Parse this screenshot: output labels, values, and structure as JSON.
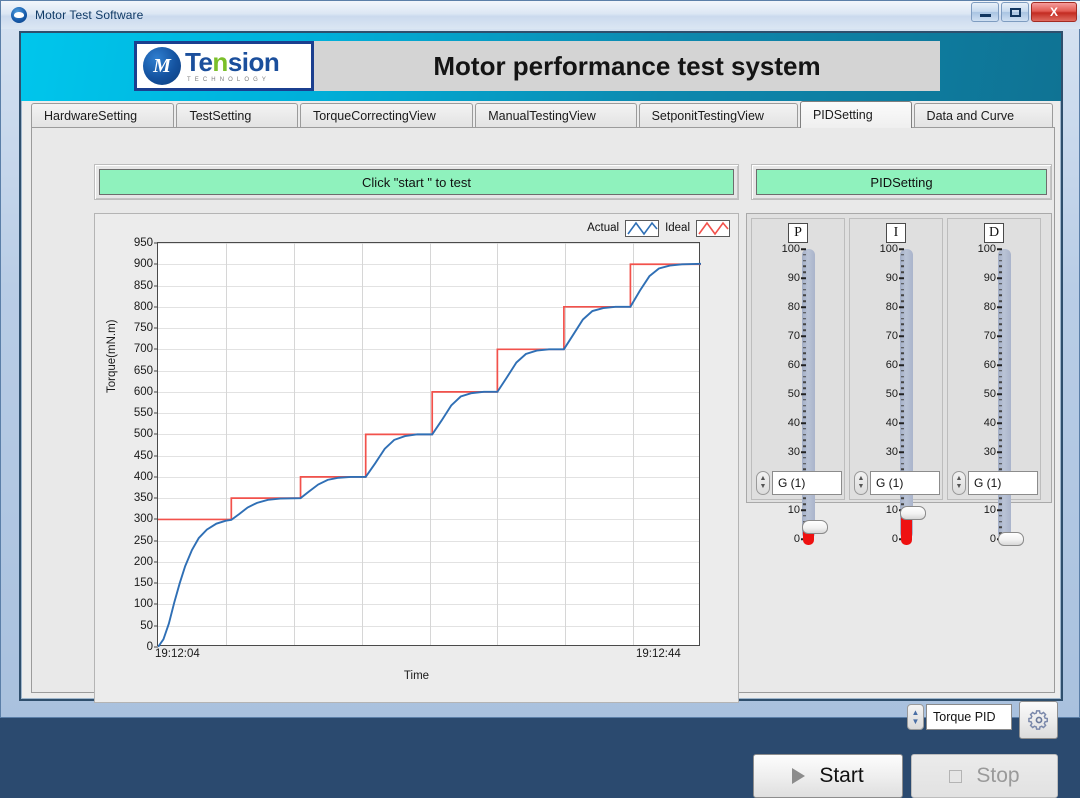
{
  "window": {
    "title": "Motor Test Software",
    "icon": "app-circle-icon",
    "buttons": {
      "minimize": "–",
      "maximize": "□",
      "close": "X"
    }
  },
  "header": {
    "title": "Motor performance test system",
    "logo": {
      "main_a": "Te",
      "main_n": "n",
      "main_b": "sion",
      "sub": "TECHNOLOGY",
      "mark": "M"
    }
  },
  "tabs": [
    {
      "label": "HardwareSetting",
      "active": false
    },
    {
      "label": "TestSetting",
      "active": false
    },
    {
      "label": "TorqueCorrectingView",
      "active": false
    },
    {
      "label": "ManualTestingView",
      "active": false
    },
    {
      "label": "SetponitTestingView",
      "active": false
    },
    {
      "label": "PIDSetting",
      "active": true
    },
    {
      "label": "Data and Curve",
      "active": false
    }
  ],
  "banners": {
    "left": "Click \"start \" to test",
    "right": "PIDSetting",
    "color": "#8ff2bd"
  },
  "legend": {
    "actual_label": "Actual",
    "ideal_label": "Ideal",
    "actual_color": "#2f6fb5",
    "ideal_color": "#f2514b"
  },
  "pid": {
    "sliders": [
      {
        "cap": "P",
        "value": 4,
        "readout": "G (1)"
      },
      {
        "cap": "I",
        "value": 9,
        "readout": "G (1)"
      },
      {
        "cap": "D",
        "value": 0,
        "readout": "G (1)"
      }
    ],
    "scale_max": 100,
    "scale_min": 0,
    "selector_value": "Torque PID",
    "gear_icon": "gear-icon"
  },
  "actions": {
    "start_label": "Start",
    "start_icon": "play-triangle-icon",
    "stop_label": "Stop",
    "stop_icon": "stop-square-icon",
    "stop_disabled": true
  },
  "chart_data": {
    "type": "line",
    "title": "",
    "xlabel": "Time",
    "ylabel": "Torque(mN.m)",
    "ylim": [
      0,
      950
    ],
    "yticks": [
      0,
      50,
      100,
      150,
      200,
      250,
      300,
      350,
      400,
      450,
      500,
      550,
      600,
      650,
      700,
      750,
      800,
      850,
      900,
      950
    ],
    "xlim_labels": [
      "19:12:04",
      "19:12:44"
    ],
    "x_start_seconds": 0,
    "x_end_seconds": 40,
    "grid": true,
    "legend_position": "top-right",
    "series": [
      {
        "name": "Ideal",
        "color": "#f2514b",
        "type": "step",
        "steps": [
          {
            "t": 0.0,
            "value": 300
          },
          {
            "t": 5.4,
            "value": 350
          },
          {
            "t": 10.5,
            "value": 400
          },
          {
            "t": 15.3,
            "value": 500
          },
          {
            "t": 20.2,
            "value": 600
          },
          {
            "t": 25.0,
            "value": 700
          },
          {
            "t": 29.9,
            "value": 800
          },
          {
            "t": 34.8,
            "value": 900
          },
          {
            "t": 40.0,
            "value": 900
          }
        ]
      },
      {
        "name": "Actual",
        "color": "#2f6fb5",
        "type": "response",
        "points": [
          {
            "t": 0.0,
            "value": 0
          },
          {
            "t": 0.4,
            "value": 18
          },
          {
            "t": 0.8,
            "value": 55
          },
          {
            "t": 1.2,
            "value": 105
          },
          {
            "t": 1.6,
            "value": 150
          },
          {
            "t": 2.0,
            "value": 190
          },
          {
            "t": 2.5,
            "value": 228
          },
          {
            "t": 3.0,
            "value": 256
          },
          {
            "t": 3.6,
            "value": 276
          },
          {
            "t": 4.3,
            "value": 290
          },
          {
            "t": 5.0,
            "value": 297
          },
          {
            "t": 5.4,
            "value": 299
          },
          {
            "t": 6.0,
            "value": 313
          },
          {
            "t": 6.6,
            "value": 328
          },
          {
            "t": 7.3,
            "value": 339
          },
          {
            "t": 8.1,
            "value": 346
          },
          {
            "t": 9.0,
            "value": 349
          },
          {
            "t": 10.5,
            "value": 350
          },
          {
            "t": 11.1,
            "value": 365
          },
          {
            "t": 11.8,
            "value": 382
          },
          {
            "t": 12.5,
            "value": 393
          },
          {
            "t": 13.3,
            "value": 398
          },
          {
            "t": 14.2,
            "value": 400
          },
          {
            "t": 15.3,
            "value": 400
          },
          {
            "t": 16.0,
            "value": 432
          },
          {
            "t": 16.7,
            "value": 466
          },
          {
            "t": 17.4,
            "value": 487
          },
          {
            "t": 18.2,
            "value": 496
          },
          {
            "t": 19.1,
            "value": 500
          },
          {
            "t": 20.2,
            "value": 500
          },
          {
            "t": 20.9,
            "value": 533
          },
          {
            "t": 21.6,
            "value": 568
          },
          {
            "t": 22.3,
            "value": 589
          },
          {
            "t": 23.1,
            "value": 597
          },
          {
            "t": 24.0,
            "value": 600
          },
          {
            "t": 25.0,
            "value": 600
          },
          {
            "t": 25.7,
            "value": 634
          },
          {
            "t": 26.4,
            "value": 669
          },
          {
            "t": 27.1,
            "value": 689
          },
          {
            "t": 27.9,
            "value": 697
          },
          {
            "t": 28.8,
            "value": 700
          },
          {
            "t": 29.9,
            "value": 700
          },
          {
            "t": 30.6,
            "value": 735
          },
          {
            "t": 31.3,
            "value": 770
          },
          {
            "t": 32.0,
            "value": 790
          },
          {
            "t": 32.8,
            "value": 797
          },
          {
            "t": 33.7,
            "value": 800
          },
          {
            "t": 34.8,
            "value": 800
          },
          {
            "t": 35.5,
            "value": 838
          },
          {
            "t": 36.2,
            "value": 872
          },
          {
            "t": 36.9,
            "value": 890
          },
          {
            "t": 37.7,
            "value": 897
          },
          {
            "t": 38.6,
            "value": 900
          },
          {
            "t": 40.0,
            "value": 901
          }
        ]
      }
    ]
  }
}
